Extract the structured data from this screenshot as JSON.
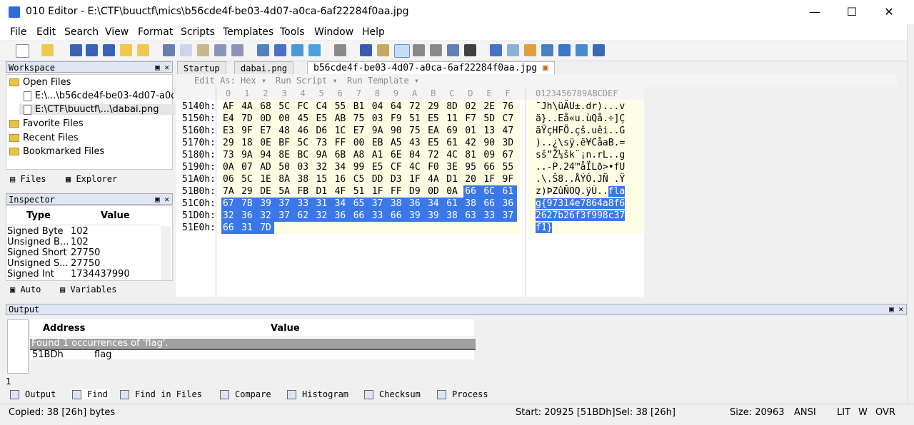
{
  "window": {
    "title": "010 Editor - E:\\CTF\\buuctf\\mics\\b56cde4f-be03-4d07-a0ca-6af22284f0aa.jpg",
    "minimize": "—",
    "maximize": "☐",
    "close": "✕"
  },
  "menu": [
    "File",
    "Edit",
    "Search",
    "View",
    "Format",
    "Scripts",
    "Templates",
    "Tools",
    "Window",
    "Help"
  ],
  "workspace": {
    "title": "Workspace",
    "open_files_label": "Open Files",
    "files": [
      "E:\\...\\b56cde4f-be03-4d07-a0c",
      "E:\\CTF\\buuctf\\...\\dabai.png"
    ],
    "favorite_label": "Favorite Files",
    "recent_label": "Recent Files",
    "bookmarked_label": "Bookmarked Files",
    "tab_files": "Files",
    "tab_explorer": "Explorer"
  },
  "inspector": {
    "title": "Inspector",
    "col_type": "Type",
    "col_value": "Value",
    "rows": [
      {
        "type": "Signed Byte",
        "value": "102"
      },
      {
        "type": "Unsigned B...",
        "value": "102"
      },
      {
        "type": "Signed Short",
        "value": "27750"
      },
      {
        "type": "Unsigned S...",
        "value": "27750"
      },
      {
        "type": "Signed Int",
        "value": "1734437990"
      }
    ],
    "tab_auto": "Auto",
    "tab_variables": "Variables"
  },
  "editor": {
    "tabs": [
      "Startup",
      "dabai.png",
      "b56cde4f-be03-4d07-a0ca-6af22284f0aa.jpg"
    ],
    "edit_as": "Edit As: Hex ▾",
    "run_script": "Run Script ▾",
    "run_template": "Run Template ▾",
    "col_headers": [
      "0",
      "1",
      "2",
      "3",
      "4",
      "5",
      "6",
      "7",
      "8",
      "9",
      "A",
      "B",
      "C",
      "D",
      "E",
      "F"
    ],
    "ascii_header": "0123456789ABCDEF",
    "rows": [
      {
        "addr": "5140h:",
        "hex": [
          "AF",
          "4A",
          "68",
          "5C",
          "FC",
          "C4",
          "55",
          "B1",
          "04",
          "64",
          "72",
          "29",
          "8D",
          "02",
          "2E",
          "76"
        ],
        "ascii": "¯Jh\\üÄU±.dr)...v",
        "sel_from": 16
      },
      {
        "addr": "5150h:",
        "hex": [
          "E4",
          "7D",
          "0D",
          "00",
          "45",
          "E5",
          "AB",
          "75",
          "03",
          "F9",
          "51",
          "E5",
          "11",
          "F7",
          "5D",
          "C7"
        ],
        "ascii": "ä}..Eå«u.ùQå.÷]Ç",
        "sel_from": 16
      },
      {
        "addr": "5160h:",
        "hex": [
          "E3",
          "9F",
          "E7",
          "48",
          "46",
          "D6",
          "1C",
          "E7",
          "9A",
          "90",
          "75",
          "EA",
          "69",
          "01",
          "13",
          "47"
        ],
        "ascii": "ãŸçHFÖ.çš.uêi..G",
        "sel_from": 16
      },
      {
        "addr": "5170h:",
        "hex": [
          "29",
          "18",
          "0E",
          "BF",
          "5C",
          "73",
          "FF",
          "00",
          "EB",
          "A5",
          "43",
          "E5",
          "61",
          "42",
          "90",
          "3D"
        ],
        "ascii": ")..¿\\sÿ.ë¥CåaB.=",
        "sel_from": 16
      },
      {
        "addr": "5180h:",
        "hex": [
          "73",
          "9A",
          "94",
          "8E",
          "BC",
          "9A",
          "6B",
          "A8",
          "A1",
          "6E",
          "04",
          "72",
          "4C",
          "81",
          "09",
          "67"
        ],
        "ascii": "sš”Ž¼šk¨¡n.rL..g",
        "sel_from": 16
      },
      {
        "addr": "5190h:",
        "hex": [
          "0A",
          "07",
          "AD",
          "50",
          "03",
          "32",
          "34",
          "99",
          "E5",
          "CF",
          "4C",
          "F0",
          "3E",
          "95",
          "66",
          "55"
        ],
        "ascii": "..-P.24™åÏLð>•fU",
        "sel_from": 16
      },
      {
        "addr": "51A0h:",
        "hex": [
          "06",
          "5C",
          "1E",
          "8A",
          "38",
          "15",
          "16",
          "C5",
          "DD",
          "D3",
          "1F",
          "4A",
          "D1",
          "20",
          "1F",
          "9F"
        ],
        "ascii": ".\\.Š8..ÅÝÓ.JÑ .Ÿ",
        "sel_from": 16
      },
      {
        "addr": "51B0h:",
        "hex": [
          "7A",
          "29",
          "DE",
          "5A",
          "FB",
          "D1",
          "4F",
          "51",
          "1F",
          "FF",
          "D9",
          "0D",
          "0A",
          "66",
          "6C",
          "61"
        ],
        "ascii": "z)ÞZûÑOQ.ÿÙ..fla",
        "sel_from": 13
      },
      {
        "addr": "51C0h:",
        "hex": [
          "67",
          "7B",
          "39",
          "37",
          "33",
          "31",
          "34",
          "65",
          "37",
          "38",
          "36",
          "34",
          "61",
          "38",
          "66",
          "36"
        ],
        "ascii": "g{97314e7864a8f6",
        "sel_from": 0
      },
      {
        "addr": "51D0h:",
        "hex": [
          "32",
          "36",
          "32",
          "37",
          "62",
          "32",
          "36",
          "66",
          "33",
          "66",
          "39",
          "39",
          "38",
          "63",
          "33",
          "37"
        ],
        "ascii": "2627b26f3f998c37",
        "sel_from": 0
      },
      {
        "addr": "51E0h:",
        "hex": [
          "66",
          "31",
          "7D"
        ],
        "ascii": "f1}",
        "sel_from": 0
      }
    ]
  },
  "output": {
    "title": "Output",
    "col_address": "Address",
    "col_value": "Value",
    "found": "Found 1 occurrences of 'flag'.",
    "result_addr": "51BDh",
    "result_value": "flag",
    "line_number": "1",
    "tabs": [
      "Output",
      "Find",
      "Find in Files",
      "Compare",
      "Histogram",
      "Checksum",
      "Process"
    ]
  },
  "status": {
    "copied": "Copied: 38 [26h] bytes",
    "start": "Start: 20925 [51BDh]",
    "sel": "Sel: 38 [26h]",
    "size": "Size: 20963",
    "encoding": "ANSI",
    "lit": "LIT",
    "w": "W",
    "ovr": "OVR"
  }
}
